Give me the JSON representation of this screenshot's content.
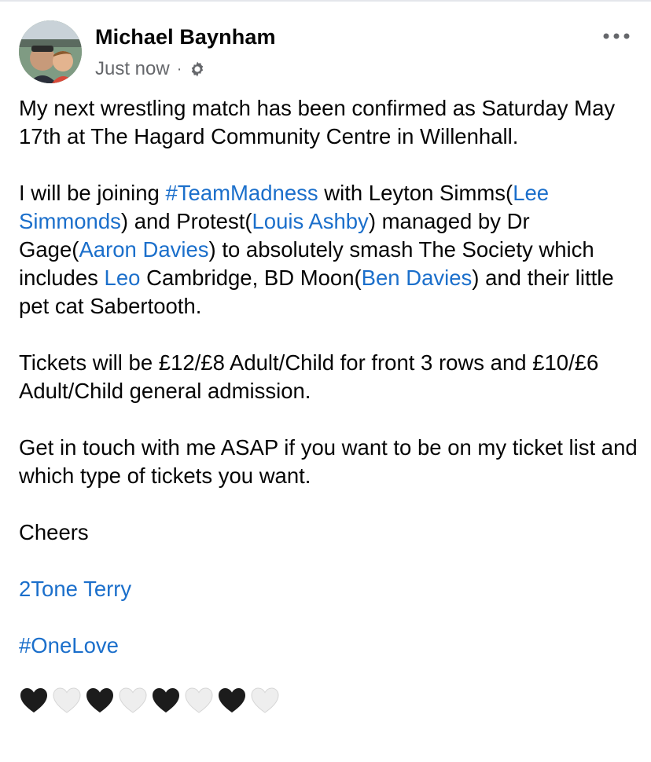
{
  "post": {
    "author": "Michael Baynham",
    "timestamp": "Just now",
    "separator": "·",
    "privacy_icon": "gear-icon",
    "more_icon": "more-horizontal-icon",
    "body": {
      "p1": "My next wrestling match has been confirmed as Saturday May 17th at The Hagard Community Centre in Willenhall.",
      "p2": {
        "t1": "I will be joining ",
        "hashtag_teammadness": "#TeamMadness",
        "t2": " with Leyton Simms(",
        "tag_lee_simmonds": "Lee Simmonds",
        "t3": ") and Protest(",
        "tag_louis_ashby": "Louis Ashby",
        "t4": ") managed by Dr Gage(",
        "tag_aaron_davies": "Aaron Davies",
        "t5": ") to absolutely smash The Society which includes ",
        "tag_leo": "Leo",
        "t6": " Cambridge, BD Moon(",
        "tag_ben_davies": "Ben Davies",
        "t7": ") and their little pet cat Sabertooth."
      },
      "p3": "Tickets will be £12/£8 Adult/Child for front 3 rows and £10/£6 Adult/Child general admission.",
      "p4": "Get in touch with me ASAP if you want to be on my ticket list and which type of tickets you want.",
      "p5": "Cheers",
      "tag_2tone_terry": "2Tone Terry",
      "hashtag_onelove": "#OneLove",
      "hearts": [
        "black",
        "white",
        "black",
        "white",
        "black",
        "white",
        "black",
        "white"
      ]
    }
  },
  "colors": {
    "link": "#1b6fcb",
    "text": "#050505",
    "meta": "#65676b",
    "heart_black": "#1c1c1c",
    "heart_white": "#eeeeee"
  }
}
